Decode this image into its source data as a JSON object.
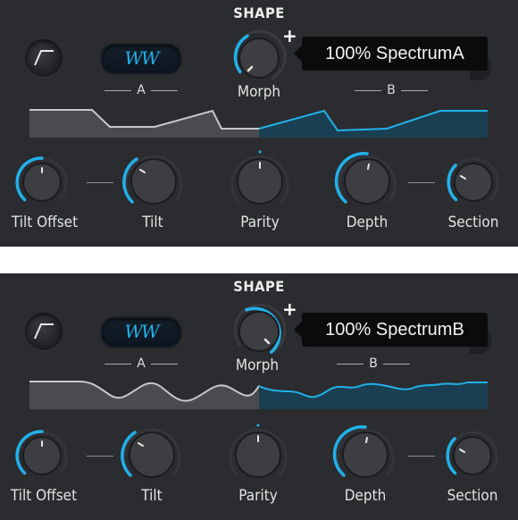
{
  "panels": [
    {
      "id": "a",
      "title": "SHAPE",
      "wave_button": "WW",
      "sublabel_a": "A",
      "sublabel_b": "B",
      "morph_label": "Morph",
      "plus": "+",
      "tooltip": "100% SpectrumA",
      "morph_value": 0.0,
      "knobs": {
        "tilt_offset": "Tilt Offset",
        "tilt": "Tilt",
        "parity": "Parity",
        "depth": "Depth",
        "section": "Section"
      }
    },
    {
      "id": "b",
      "title": "SHAPE",
      "wave_button": "WW",
      "sublabel_a": "A",
      "sublabel_b": "B",
      "morph_label": "Morph",
      "plus": "+",
      "tooltip": "100% SpectrumB",
      "morph_value": 1.0,
      "knobs": {
        "tilt_offset": "Tilt Offset",
        "tilt": "Tilt",
        "parity": "Parity",
        "depth": "Depth",
        "section": "Section"
      }
    }
  ],
  "colors": {
    "accent": "#21b1ea",
    "panel": "#2b2c2f",
    "knob": "#3b3c40"
  }
}
